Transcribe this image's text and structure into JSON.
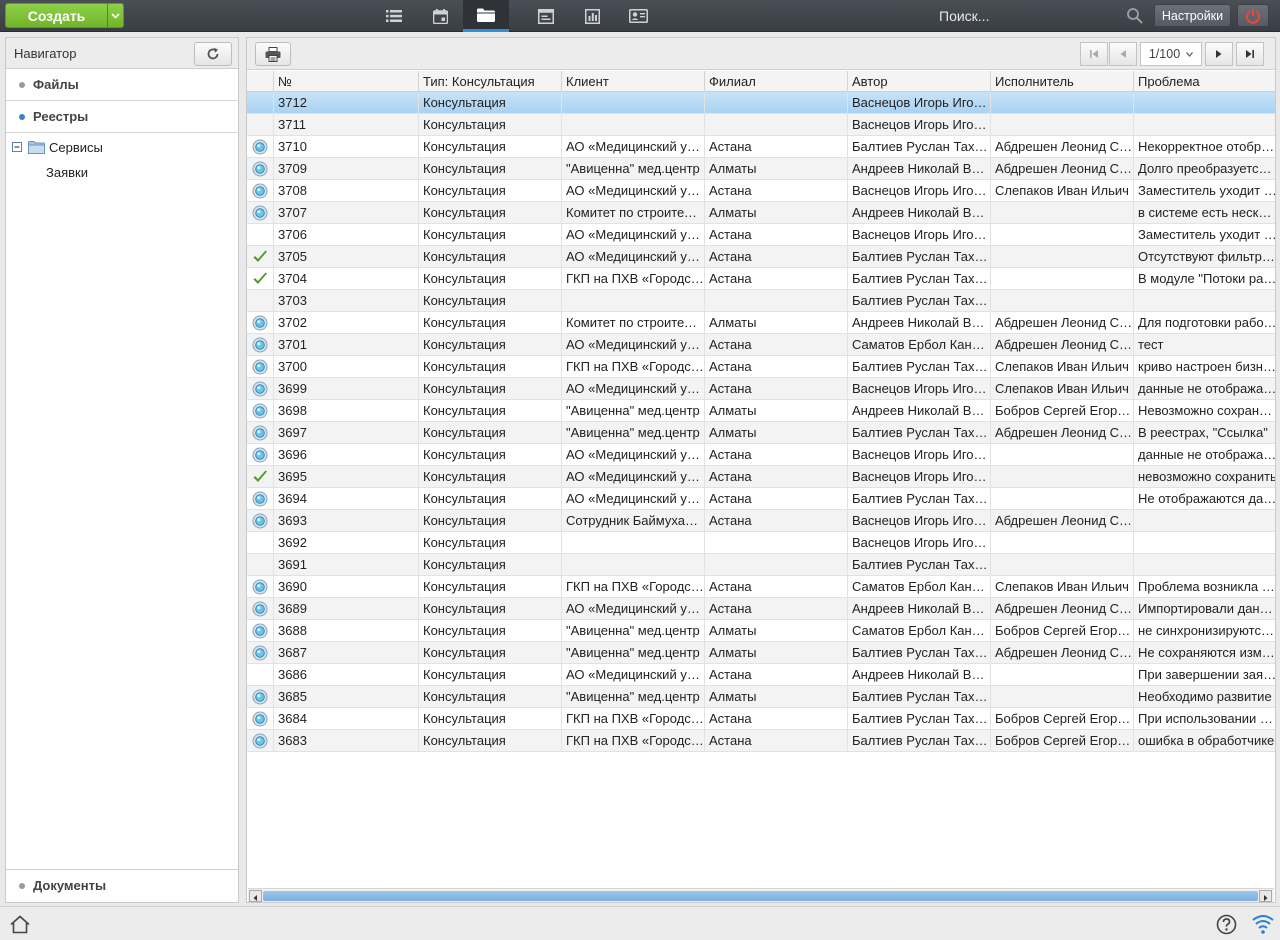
{
  "topbar": {
    "create_label": "Создать",
    "search_placeholder": "Поиск...",
    "settings_label": "Настройки",
    "nav_icons": [
      "list-icon",
      "calendar-icon",
      "folder-icon",
      "window-icon",
      "chart-icon",
      "contact-card-icon"
    ],
    "active_icon": "folder-icon"
  },
  "navigator": {
    "title": "Навигатор",
    "sections": [
      {
        "label": "Файлы",
        "active": false
      },
      {
        "label": "Реестры",
        "active": true
      }
    ],
    "tree": {
      "folder_label": "Сервисы",
      "child_label": "Заявки"
    },
    "bottom_label": "Документы"
  },
  "pager": {
    "page_value": "1/100"
  },
  "grid": {
    "columns": [
      "",
      "№",
      "Тип: Консультация",
      "Клиент",
      "Филиал",
      "Автор",
      "Исполнитель",
      "Проблема"
    ],
    "rows": [
      {
        "status": "none",
        "num": "3712",
        "type": "Консультация",
        "client": "",
        "branch": "",
        "author": "Васнецов Игорь Игоревич",
        "executor": "",
        "problem": "",
        "selected": true
      },
      {
        "status": "none",
        "num": "3711",
        "type": "Консультация",
        "client": "",
        "branch": "",
        "author": "Васнецов Игорь Игоревич",
        "executor": "",
        "problem": ""
      },
      {
        "status": "progress",
        "num": "3710",
        "type": "Консультация",
        "client": "АО «Медицинский университет Астана»",
        "branch": "Астана",
        "author": "Балтиев Руслан Тахирович",
        "executor": "Абдрешен Леонид Сергеевич",
        "problem": "Некорректное отображение"
      },
      {
        "status": "progress",
        "num": "3709",
        "type": "Консультация",
        "client": "\"Авиценна\" мед.центр",
        "branch": "Алматы",
        "author": "Андреев Николай Викторович",
        "executor": "Абдрешен Леонид Сергеевич",
        "problem": "Долго преобразуется документ"
      },
      {
        "status": "progress",
        "num": "3708",
        "type": "Консультация",
        "client": "АО «Медицинский университет Астана»",
        "branch": "Астана",
        "author": "Васнецов Игорь Игоревич",
        "executor": "Слепаков Иван Ильич",
        "problem": "Заместитель уходит в отпуск"
      },
      {
        "status": "progress",
        "num": "3707",
        "type": "Консультация",
        "client": "Комитет по строительству",
        "branch": "Алматы",
        "author": "Андреев Николай Викторович",
        "executor": "",
        "problem": "в системе есть несколько записей"
      },
      {
        "status": "none",
        "num": "3706",
        "type": "Консультация",
        "client": "АО «Медицинский университет Астана»",
        "branch": "Астана",
        "author": "Васнецов Игорь Игоревич",
        "executor": "",
        "problem": "Заместитель уходит в отпуск"
      },
      {
        "status": "done",
        "num": "3705",
        "type": "Консультация",
        "client": "АО «Медицинский университет Астана»",
        "branch": "Астана",
        "author": "Балтиев Руслан Тахирович",
        "executor": "",
        "problem": "Отсутствуют фильтры в реестре"
      },
      {
        "status": "done",
        "num": "3704",
        "type": "Консультация",
        "client": "ГКП на ПХВ «Городская больница»",
        "branch": "Астана",
        "author": "Балтиев Руслан Тахирович",
        "executor": "",
        "problem": "В модуле \"Потоки работ\""
      },
      {
        "status": "none",
        "num": "3703",
        "type": "Консультация",
        "client": "",
        "branch": "",
        "author": "Балтиев Руслан Тахирович",
        "executor": "",
        "problem": ""
      },
      {
        "status": "progress",
        "num": "3702",
        "type": "Консультация",
        "client": "Комитет по строительству",
        "branch": "Алматы",
        "author": "Андреев Николай Викторович",
        "executor": "Абдрешен Леонид Сергеевич",
        "problem": "Для подготовки работы"
      },
      {
        "status": "progress",
        "num": "3701",
        "type": "Консультация",
        "client": "АО «Медицинский университет Астана»",
        "branch": "Астана",
        "author": "Саматов Ербол Канатович",
        "executor": "Абдрешен Леонид Сергеевич",
        "problem": "тест"
      },
      {
        "status": "progress",
        "num": "3700",
        "type": "Консультация",
        "client": "ГКП на ПХВ «Городская больница»",
        "branch": "Астана",
        "author": "Балтиев Руслан Тахирович",
        "executor": "Слепаков Иван Ильич",
        "problem": "криво настроен бизнес-процесс"
      },
      {
        "status": "progress",
        "num": "3699",
        "type": "Консультация",
        "client": "АО «Медицинский университет Астана»",
        "branch": "Астана",
        "author": "Васнецов Игорь Игоревич",
        "executor": "Слепаков Иван Ильич",
        "problem": "данные не отображаются"
      },
      {
        "status": "progress",
        "num": "3698",
        "type": "Консультация",
        "client": "\"Авиценна\" мед.центр",
        "branch": "Алматы",
        "author": "Андреев Николай Викторович",
        "executor": "Бобров Сергей Егорович",
        "problem": "Невозможно сохранить"
      },
      {
        "status": "progress",
        "num": "3697",
        "type": "Консультация",
        "client": "\"Авиценна\" мед.центр",
        "branch": "Алматы",
        "author": "Балтиев Руслан Тахирович",
        "executor": "Абдрешен Леонид Сергеевич",
        "problem": "В реестрах, \"Ссылка\""
      },
      {
        "status": "progress",
        "num": "3696",
        "type": "Консультация",
        "client": "АО «Медицинский университет Астана»",
        "branch": "Астана",
        "author": "Васнецов Игорь Игоревич",
        "executor": "",
        "problem": "данные не отображаются"
      },
      {
        "status": "done",
        "num": "3695",
        "type": "Консультация",
        "client": "АО «Медицинский университет Астана»",
        "branch": "Астана",
        "author": "Васнецов Игорь Игоревич",
        "executor": "",
        "problem": "невозможно сохранить"
      },
      {
        "status": "progress",
        "num": "3694",
        "type": "Консультация",
        "client": "АО «Медицинский университет Астана»",
        "branch": "Астана",
        "author": "Балтиев Руслан Тахирович",
        "executor": "",
        "problem": "Не отображаются данные"
      },
      {
        "status": "progress",
        "num": "3693",
        "type": "Консультация",
        "client": "Сотрудник Баймуханов",
        "branch": "Астана",
        "author": "Васнецов Игорь Игоревич",
        "executor": "Абдрешен Леонид Сергеевич",
        "problem": ""
      },
      {
        "status": "none",
        "num": "3692",
        "type": "Консультация",
        "client": "",
        "branch": "",
        "author": "Васнецов Игорь Игоревич",
        "executor": "",
        "problem": ""
      },
      {
        "status": "none",
        "num": "3691",
        "type": "Консультация",
        "client": "",
        "branch": "",
        "author": "Балтиев Руслан Тахирович",
        "executor": "",
        "problem": ""
      },
      {
        "status": "progress",
        "num": "3690",
        "type": "Консультация",
        "client": "ГКП на ПХВ «Городская больница»",
        "branch": "Астана",
        "author": "Саматов Ербол Канатович",
        "executor": "Слепаков Иван Ильич",
        "problem": "Проблема возникла в модуле"
      },
      {
        "status": "progress",
        "num": "3689",
        "type": "Консультация",
        "client": "АО «Медицинский университет Астана»",
        "branch": "Астана",
        "author": "Андреев Николай Викторович",
        "executor": "Абдрешен Леонид Сергеевич",
        "problem": "Импортировали данные"
      },
      {
        "status": "progress",
        "num": "3688",
        "type": "Консультация",
        "client": "\"Авиценна\" мед.центр",
        "branch": "Алматы",
        "author": "Саматов Ербол Канатович",
        "executor": "Бобров Сергей Егорович",
        "problem": "не синхронизируются данные"
      },
      {
        "status": "progress",
        "num": "3687",
        "type": "Консультация",
        "client": "\"Авиценна\" мед.центр",
        "branch": "Алматы",
        "author": "Балтиев Руслан Тахирович",
        "executor": "Абдрешен Леонид Сергеевич",
        "problem": "Не сохраняются изменения"
      },
      {
        "status": "none",
        "num": "3686",
        "type": "Консультация",
        "client": "АО «Медицинский университет Астана»",
        "branch": "Астана",
        "author": "Андреев Николай Викторович",
        "executor": "",
        "problem": "При завершении заявки"
      },
      {
        "status": "progress",
        "num": "3685",
        "type": "Консультация",
        "client": "\"Авиценна\" мед.центр",
        "branch": "Алматы",
        "author": "Балтиев Руслан Тахирович",
        "executor": "",
        "problem": "Необходимо развитие"
      },
      {
        "status": "progress",
        "num": "3684",
        "type": "Консультация",
        "client": "ГКП на ПХВ «Городская больница»",
        "branch": "Астана",
        "author": "Балтиев Руслан Тахирович",
        "executor": "Бобров Сергей Егорович",
        "problem": "При использовании фильтра"
      },
      {
        "status": "progress",
        "num": "3683",
        "type": "Консультация",
        "client": "ГКП на ПХВ «Городская больница»",
        "branch": "Астана",
        "author": "Балтиев Руслан Тахирович",
        "executor": "Бобров Сергей Егорович",
        "problem": "ошибка в обработчике"
      }
    ]
  },
  "colors": {
    "accent": "#7bc236",
    "selection": "#b7dbf5",
    "topbar": "#42474e",
    "power": "#e8402a"
  }
}
